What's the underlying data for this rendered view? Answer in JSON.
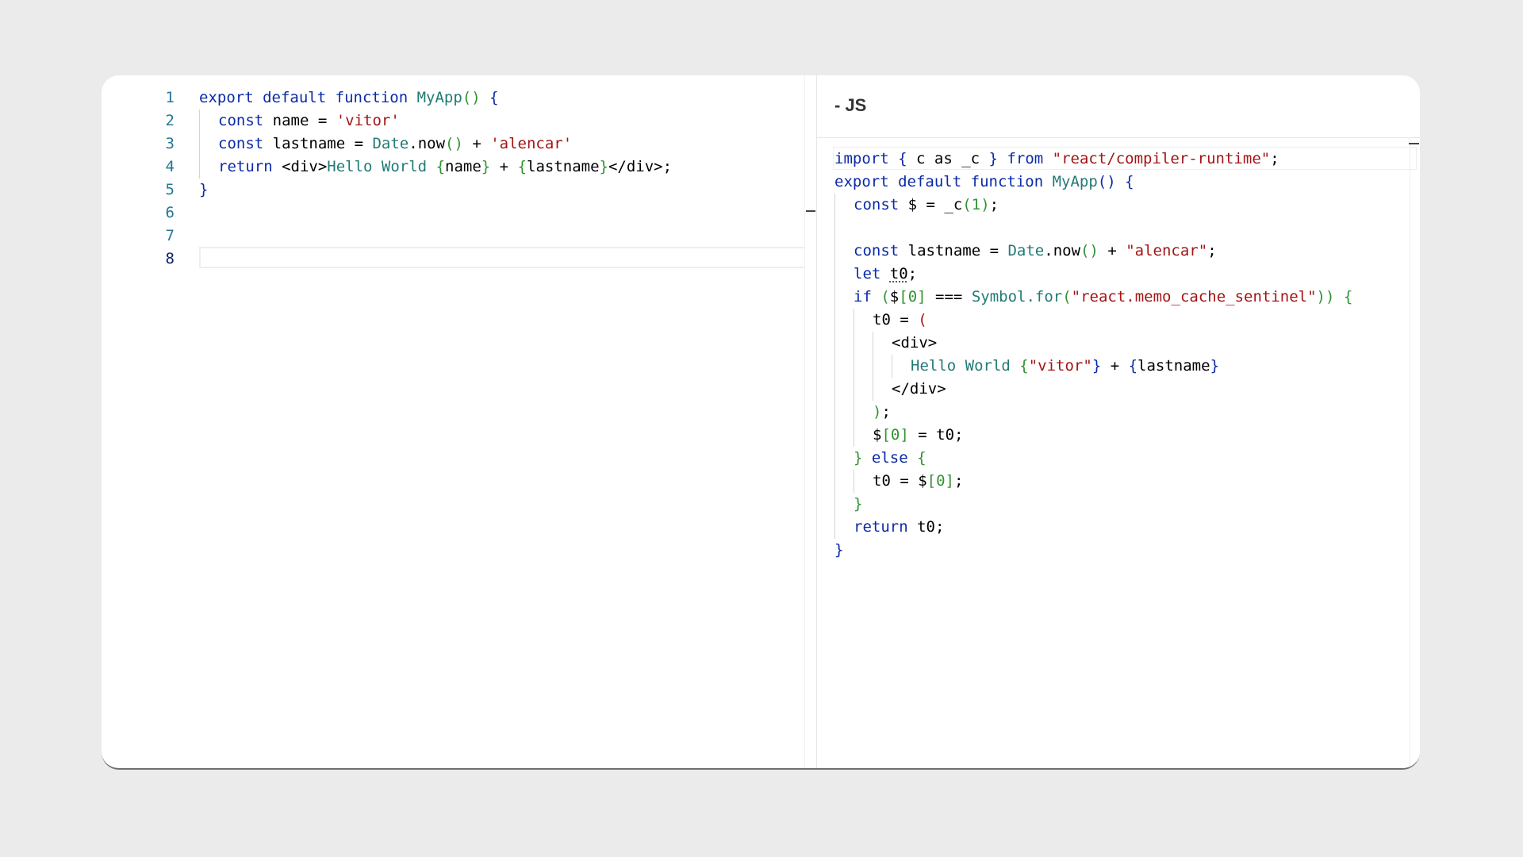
{
  "editor": {
    "line_numbers": [
      "1",
      "2",
      "3",
      "4",
      "5",
      "6",
      "7",
      "8"
    ],
    "current_line": "8",
    "lines": [
      [
        {
          "t": "export",
          "c": "k"
        },
        {
          "t": " "
        },
        {
          "t": "default",
          "c": "k"
        },
        {
          "t": " "
        },
        {
          "t": "function",
          "c": "k"
        },
        {
          "t": " "
        },
        {
          "t": "MyApp",
          "c": "f"
        },
        {
          "t": "()",
          "c": "g"
        },
        {
          "t": " "
        },
        {
          "t": "{",
          "c": "p"
        }
      ],
      [
        {
          "t": "const",
          "c": "k"
        },
        {
          "t": " name = "
        },
        {
          "t": "'vitor'",
          "c": "s"
        }
      ],
      [
        {
          "t": "const",
          "c": "k"
        },
        {
          "t": " lastname = "
        },
        {
          "t": "Date",
          "c": "f"
        },
        {
          "t": ".now"
        },
        {
          "t": "()",
          "c": "g"
        },
        {
          "t": " + "
        },
        {
          "t": "'alencar'",
          "c": "s"
        }
      ],
      [
        {
          "t": "return",
          "c": "k"
        },
        {
          "t": " <div>"
        },
        {
          "t": "Hello World ",
          "c": "f"
        },
        {
          "t": "{",
          "c": "g"
        },
        {
          "t": "name"
        },
        {
          "t": "}",
          "c": "g"
        },
        {
          "t": " + "
        },
        {
          "t": "{",
          "c": "g"
        },
        {
          "t": "lastname"
        },
        {
          "t": "}",
          "c": "g"
        },
        {
          "t": "</div>;"
        }
      ],
      [
        {
          "t": "}",
          "c": "p"
        }
      ],
      [],
      [],
      []
    ],
    "indents": [
      0,
      1,
      1,
      1,
      0,
      0,
      0,
      0
    ]
  },
  "output": {
    "tab_title": "- JS",
    "lines": [
      [
        {
          "t": "import",
          "c": "k"
        },
        {
          "t": " "
        },
        {
          "t": "{",
          "c": "p"
        },
        {
          "t": " c "
        },
        {
          "t": "as"
        },
        {
          "t": " _c "
        },
        {
          "t": "}",
          "c": "p"
        },
        {
          "t": " "
        },
        {
          "t": "from",
          "c": "k"
        },
        {
          "t": " "
        },
        {
          "t": "\"react/compiler-runtime\"",
          "c": "s"
        },
        {
          "t": ";"
        }
      ],
      [
        {
          "t": "export",
          "c": "k"
        },
        {
          "t": " "
        },
        {
          "t": "default",
          "c": "k"
        },
        {
          "t": " "
        },
        {
          "t": "function",
          "c": "k"
        },
        {
          "t": " "
        },
        {
          "t": "MyApp",
          "c": "f"
        },
        {
          "t": "()",
          "c": "p"
        },
        {
          "t": " "
        },
        {
          "t": "{",
          "c": "p"
        }
      ],
      [
        {
          "t": "const",
          "c": "k"
        },
        {
          "t": " $ = _c"
        },
        {
          "t": "(",
          "c": "g"
        },
        {
          "t": "1",
          "c": "g"
        },
        {
          "t": ")",
          "c": "g"
        },
        {
          "t": ";"
        }
      ],
      [],
      [
        {
          "t": "const",
          "c": "k"
        },
        {
          "t": " lastname = "
        },
        {
          "t": "Date",
          "c": "f"
        },
        {
          "t": ".now"
        },
        {
          "t": "()",
          "c": "g"
        },
        {
          "t": " + "
        },
        {
          "t": "\"alencar\"",
          "c": "s"
        },
        {
          "t": ";"
        }
      ],
      [
        {
          "t": "let",
          "c": "k"
        },
        {
          "t": " "
        },
        {
          "t": "t0",
          "c": "sq"
        },
        {
          "t": ";"
        }
      ],
      [
        {
          "t": "if",
          "c": "k"
        },
        {
          "t": " "
        },
        {
          "t": "(",
          "c": "g"
        },
        {
          "t": "$"
        },
        {
          "t": "[",
          "c": "g"
        },
        {
          "t": "0",
          "c": "g"
        },
        {
          "t": "]",
          "c": "g"
        },
        {
          "t": " === "
        },
        {
          "t": "Symbol",
          "c": "f"
        },
        {
          "t": ".for",
          "c": "f"
        },
        {
          "t": "(",
          "c": "g"
        },
        {
          "t": "\"react.memo_cache_sentinel\"",
          "c": "s"
        },
        {
          "t": "))",
          "c": "g"
        },
        {
          "t": " "
        },
        {
          "t": "{",
          "c": "g"
        }
      ],
      [
        {
          "t": "t0 = "
        },
        {
          "t": "(",
          "c": "s"
        }
      ],
      [
        {
          "t": "<div>"
        }
      ],
      [
        {
          "t": "Hello World ",
          "c": "f"
        },
        {
          "t": "{",
          "c": "g"
        },
        {
          "t": "\"vitor\"",
          "c": "s"
        },
        {
          "t": "}",
          "c": "p"
        },
        {
          "t": " + "
        },
        {
          "t": "{",
          "c": "p"
        },
        {
          "t": "lastname"
        },
        {
          "t": "}",
          "c": "p"
        }
      ],
      [
        {
          "t": "</div>"
        }
      ],
      [
        {
          "t": ")",
          "c": "g"
        },
        {
          "t": ";"
        }
      ],
      [
        {
          "t": "$"
        },
        {
          "t": "[",
          "c": "g"
        },
        {
          "t": "0",
          "c": "g"
        },
        {
          "t": "]",
          "c": "g"
        },
        {
          "t": " = t0;"
        }
      ],
      [
        {
          "t": "}",
          "c": "g"
        },
        {
          "t": " "
        },
        {
          "t": "else",
          "c": "k"
        },
        {
          "t": " "
        },
        {
          "t": "{",
          "c": "g"
        }
      ],
      [
        {
          "t": "t0 = $"
        },
        {
          "t": "[",
          "c": "g"
        },
        {
          "t": "0",
          "c": "g"
        },
        {
          "t": "]",
          "c": "g"
        },
        {
          "t": ";"
        }
      ],
      [
        {
          "t": "}",
          "c": "g"
        }
      ],
      [
        {
          "t": "return",
          "c": "k"
        },
        {
          "t": " t0;"
        }
      ],
      [
        {
          "t": "}",
          "c": "p"
        }
      ]
    ],
    "indents": [
      0,
      0,
      1,
      1,
      1,
      1,
      1,
      2,
      3,
      4,
      3,
      2,
      2,
      1,
      2,
      1,
      1,
      0
    ]
  }
}
